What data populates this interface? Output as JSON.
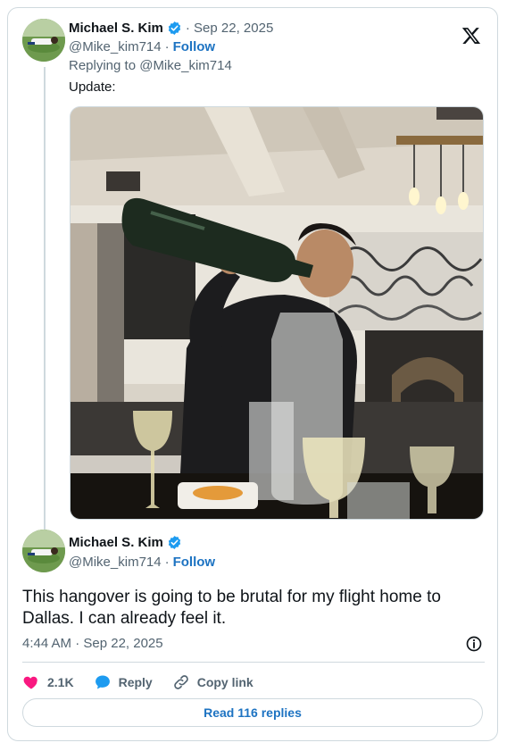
{
  "parent_tweet": {
    "author_name": "Michael S. Kim",
    "date": "· Sep 22, 2025",
    "handle": "@Mike_kim714",
    "separator": "·",
    "follow_label": "Follow",
    "replying_to": "Replying to @Mike_kim714",
    "text": "Update:"
  },
  "embed_tweet": {
    "author_name": "Michael S. Kim",
    "handle": "@Mike_kim714",
    "separator": "·",
    "follow_label": "Follow",
    "text": "This hangover is going to be brutal for my flight home to Dallas. I can already feel it.",
    "timestamp": "4:44 AM · Sep 22, 2025"
  },
  "actions": {
    "like_count": "2.1K",
    "reply_label": "Reply",
    "copy_label": "Copy link"
  },
  "read_replies_label": "Read 116 replies",
  "icons": {
    "verified": "verified-badge-icon",
    "brand": "x-logo-icon",
    "info": "info-icon",
    "like": "heart-icon",
    "reply": "reply-bubble-icon",
    "copy": "link-icon"
  },
  "colors": {
    "link_blue": "#1d73c2",
    "verified_blue": "#1d9bf0",
    "heart_pink": "#f91880",
    "border": "#cfd9de",
    "muted_text": "#536471"
  }
}
